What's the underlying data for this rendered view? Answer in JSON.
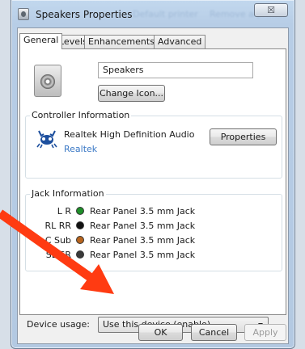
{
  "window": {
    "title": "Speakers Properties",
    "close_label": "☒",
    "blur_title_1": "Default printer",
    "blur_title_2": "Remove a printer"
  },
  "tabs": [
    {
      "label": "General",
      "active": true
    },
    {
      "label": "Levels",
      "active": false
    },
    {
      "label": "Enhancements",
      "active": false
    },
    {
      "label": "Advanced",
      "active": false
    }
  ],
  "general": {
    "device_name_value": "Speakers",
    "change_icon_label": "Change Icon...",
    "controller": {
      "group_label": "Controller Information",
      "device": "Realtek High Definition Audio",
      "vendor": "Realtek",
      "properties_label": "Properties"
    },
    "jack": {
      "group_label": "Jack Information",
      "rows": [
        {
          "channel": "L R",
          "color": "#1f8f2a",
          "description": "Rear Panel 3.5 mm Jack"
        },
        {
          "channel": "RL RR",
          "color": "#111111",
          "description": "Rear Panel 3.5 mm Jack"
        },
        {
          "channel": "C Sub",
          "color": "#b8651e",
          "description": "Rear Panel 3.5 mm Jack"
        },
        {
          "channel": "SL SR",
          "color": "#3a3a3a",
          "description": "Rear Panel 3.5 mm Jack"
        }
      ]
    },
    "device_usage": {
      "label": "Device usage:",
      "selected": "Use this device (enable)"
    }
  },
  "footer": {
    "ok_label": "OK",
    "cancel_label": "Cancel",
    "apply_label": "Apply"
  },
  "colors": {
    "annotation_arrow": "#ff3b12",
    "link": "#3a78c5"
  },
  "icons": {
    "title": "speaker-properties-icon",
    "device": "speaker-icon",
    "vendor": "realtek-crab-icon"
  }
}
